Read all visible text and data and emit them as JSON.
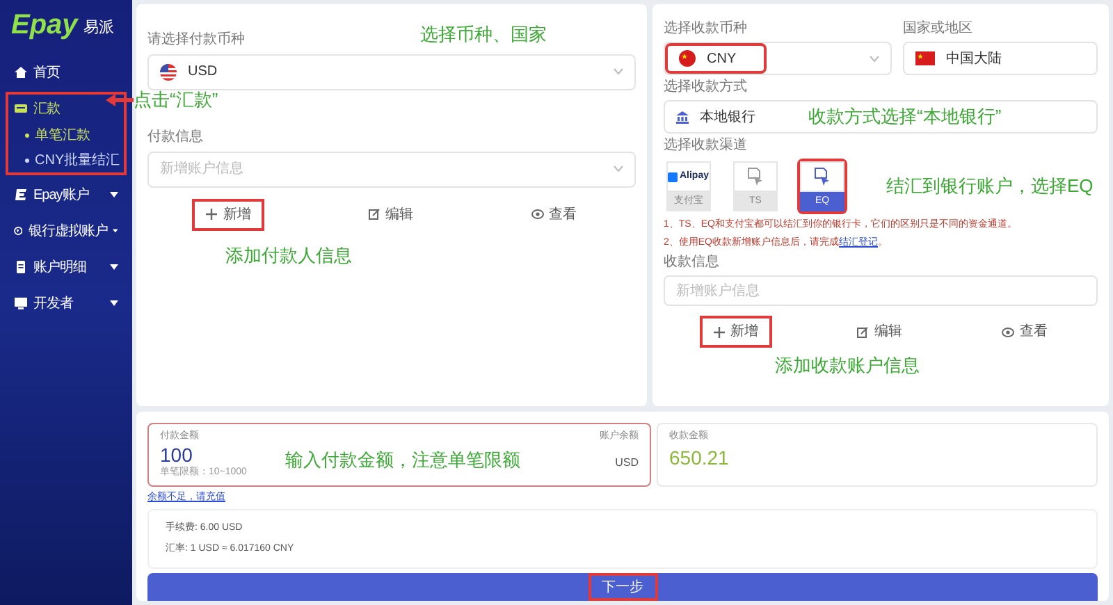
{
  "sidebar": {
    "logo": {
      "brand": "Epay",
      "brand_cn": "易派"
    },
    "items": [
      {
        "label": "首页",
        "selected": false
      },
      {
        "label": "汇款",
        "selected": true,
        "expanded": true,
        "highlighted": true,
        "children": [
          {
            "label": "单笔汇款",
            "selected": true
          },
          {
            "label": "CNY批量结汇",
            "selected": false
          }
        ]
      },
      {
        "label": "Epay账户",
        "selected": false,
        "expanded": false
      },
      {
        "label": "银行虚拟账户",
        "selected": false,
        "expanded": false
      },
      {
        "label": "账户明细",
        "selected": false,
        "expanded": false
      },
      {
        "label": "开发者",
        "selected": false,
        "expanded": false
      }
    ],
    "annotation": "点击“汇款”"
  },
  "payer": {
    "currency_label": "请选择付款币种",
    "currency": "USD",
    "annotation_currency": "选择币种、国家",
    "info_label": "付款信息",
    "info_placeholder": "新增账户信息",
    "actions": [
      {
        "label": "新增",
        "highlighted": true
      },
      {
        "label": "编辑",
        "highlighted": false
      },
      {
        "label": "查看",
        "highlighted": false
      }
    ],
    "annotation": "添加付款人信息"
  },
  "payee": {
    "currency_label": "选择收款币种",
    "currency": "CNY",
    "currency_highlighted": true,
    "region_label": "国家或地区",
    "region": "中国大陆",
    "method_label": "选择收款方式",
    "method": "本地银行",
    "annotation_method": "收款方式选择“本地银行”",
    "channel_label": "选择收款渠道",
    "channels": [
      {
        "kind": "alipay",
        "logo": "Alipay",
        "label": "支付宝",
        "selected": false,
        "highlighted": false
      },
      {
        "kind": "doc",
        "label": "TS",
        "selected": false,
        "highlighted": false
      },
      {
        "kind": "doc",
        "label": "EQ",
        "selected": true,
        "highlighted": true
      }
    ],
    "annotation_channel": "结汇到银行账户，选择EQ",
    "notes": [
      {
        "text": "1、TS、EQ和支付宝都可以结汇到你的银行卡，它们的区别只是不同的资金通道。"
      },
      {
        "text": "2、使用EQ收款新增账户信息后，请完成",
        "link": "结汇登记",
        "after": "。"
      }
    ],
    "info_label": "收款信息",
    "info_placeholder": "新增账户信息",
    "actions": [
      {
        "label": "新增",
        "highlighted": true
      },
      {
        "label": "编辑",
        "highlighted": false
      },
      {
        "label": "查看",
        "highlighted": false
      }
    ],
    "annotation": "添加收款账户信息"
  },
  "amount": {
    "label": "付款金额",
    "value": "100",
    "limit": "单笔限额：10~1000",
    "balance_label": "账户余额",
    "currency": "USD",
    "highlighted": true,
    "annotation": "输入付款金额，注意单笔限额",
    "receive_label": "收款金额",
    "receive_value": "650.21",
    "topup_link": "余额不足，请充值",
    "fee": "手续费: 6.00 USD",
    "rate": "汇率: 1 USD ≈ 6.017160 CNY"
  },
  "submit": {
    "label": "下一步",
    "highlighted": true
  }
}
